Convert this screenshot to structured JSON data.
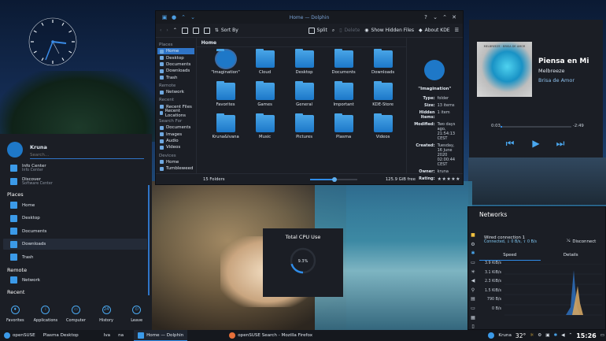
{
  "dolphin": {
    "title": "Home — Dolphin",
    "toolbar": {
      "sort_by": "Sort By",
      "split": "Split",
      "delete": "Delete",
      "show_hidden": "Show Hidden Files",
      "about": "About KDE"
    },
    "places": [
      {
        "type": "header",
        "label": "Places"
      },
      {
        "label": "Home",
        "selected": true
      },
      {
        "label": "Desktop"
      },
      {
        "label": "Documents"
      },
      {
        "label": "Downloads"
      },
      {
        "label": "Trash"
      },
      {
        "type": "header",
        "label": "Remote"
      },
      {
        "label": "Network"
      },
      {
        "type": "header",
        "label": "Recent"
      },
      {
        "label": "Recent Files"
      },
      {
        "label": "Recent Locations"
      },
      {
        "type": "header",
        "label": "Search For"
      },
      {
        "label": "Documents"
      },
      {
        "label": "Images"
      },
      {
        "label": "Audio"
      },
      {
        "label": "Videos"
      },
      {
        "type": "header",
        "label": "Devices"
      },
      {
        "label": "Home"
      },
      {
        "label": "Tumbleweed"
      }
    ],
    "breadcrumb": "Home",
    "files": [
      "\"Imagination\"",
      "Cloud",
      "Desktop",
      "Documents",
      "Downloads",
      "Favorites",
      "Games",
      "General",
      "Important",
      "KDE-Store",
      "Kruna&Ivana",
      "Music",
      "Pictures",
      "Plasma",
      "Videos"
    ],
    "info": {
      "name": "\"Imagination\"",
      "rows": [
        {
          "k": "Type:",
          "v": "folder"
        },
        {
          "k": "Size:",
          "v": "13 items"
        },
        {
          "k": "Hidden Items:",
          "v": "1 item"
        },
        {
          "k": "Modified:",
          "v": "Two days ago, 21:54:13 CEST"
        },
        {
          "k": "Created:",
          "v": "Tuesday, 16 June 2020 02:00:44 CEST"
        },
        {
          "k": "Owner:",
          "v": "kruna"
        }
      ],
      "rating_label": "Rating:",
      "rating": "★★★★★"
    },
    "status": {
      "folders": "15 Folders",
      "free": "125.9 GiB free"
    }
  },
  "player": {
    "cover_label": "MELBREEZE · BRISA DE AMOR",
    "title": "Piensa en Mi",
    "artist": "Melbreeze",
    "album": "Brisa de Amor",
    "elapsed": "0:03",
    "remaining": "-2:49",
    "progress": 0.02,
    "prev": "⏮",
    "play": "▶",
    "next": "⏭"
  },
  "networks": {
    "title": "Networks",
    "connection": "Wired connection 1",
    "status": "Connected, ⇩ 0 B/s, ⇧ 0 B/s",
    "disconnect": "Disconnect",
    "tabs": [
      "Speed",
      "Details"
    ],
    "y_labels": [
      "3.9 KiB/s",
      "3.1 KiB/s",
      "2.3 KiB/s",
      "1.5 KiB/s",
      "790 B/s",
      "0 B/s"
    ]
  },
  "cpu": {
    "title": "Total CPU Use",
    "percent": "9.3%",
    "value": 0.093
  },
  "launcher": {
    "user": "Kruna",
    "search_placeholder": "Search...",
    "favorites": [
      {
        "label": "Info Center",
        "sub": "Info Center"
      },
      {
        "label": "Discover",
        "sub": "Software Center"
      }
    ],
    "places_header": "Places",
    "places": [
      "Home",
      "Desktop",
      "Documents",
      "Downloads",
      "Trash"
    ],
    "remote_header": "Remote",
    "remote": [
      "Network"
    ],
    "recent_header": "Recent",
    "tabs": [
      "Favorites",
      "Applications",
      "Computer",
      "History",
      "Leave"
    ]
  },
  "taskbar": {
    "items": [
      "openSUSE",
      "Plasma Desktop",
      "Iva",
      "na",
      "Home — Dolphin",
      "openSUSE Search - Mozilla Firefox"
    ],
    "user": "Kruna",
    "temp": "32°",
    "time": "15:26"
  }
}
